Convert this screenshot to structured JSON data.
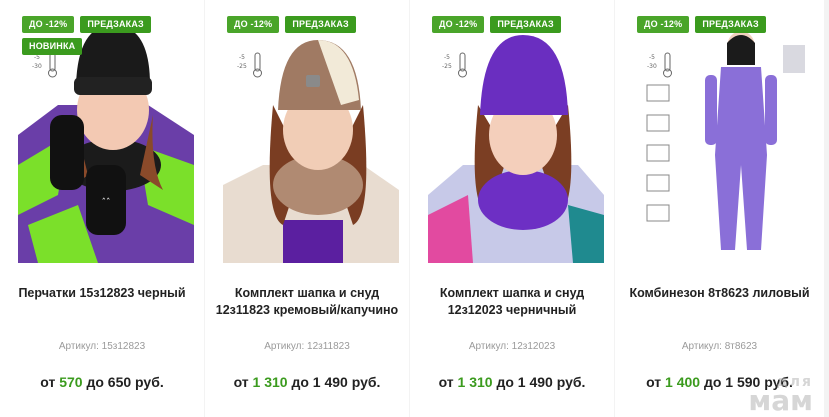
{
  "products": [
    {
      "badges": [
        "ДО -12%",
        "ПРЕДЗАКАЗ",
        "НОВИНКА"
      ],
      "name": "Перчатки 15з12823 черный",
      "sku": "Артикул: 15з12823",
      "price_from_label": "от",
      "price_from": "570",
      "price_to_label": "до",
      "price_to": "650 руб.",
      "temp": [
        "-5",
        "-30"
      ]
    },
    {
      "badges": [
        "ДО -12%",
        "ПРЕДЗАКАЗ"
      ],
      "name": "Комплект шапка и снуд 12з11823 кремовый/капучино",
      "sku": "Артикул: 12з11823",
      "price_from_label": "от",
      "price_from": "1 310",
      "price_to_label": "до",
      "price_to": "1 490 руб.",
      "temp": [
        "-5",
        "-25"
      ]
    },
    {
      "badges": [
        "ДО -12%",
        "ПРЕДЗАКАЗ"
      ],
      "name": "Комплект шапка и снуд 12з12023 черничный",
      "sku": "Артикул: 12з12023",
      "price_from_label": "от",
      "price_from": "1 310",
      "price_to_label": "до",
      "price_to": "1 490 руб.",
      "temp": [
        "-5",
        "-25"
      ]
    },
    {
      "badges": [
        "ДО -12%",
        "ПРЕДЗАКАЗ"
      ],
      "name": "Комбинезон 8т8623 лиловый",
      "sku": "Артикул: 8т8623",
      "price_from_label": "от",
      "price_from": "1 400",
      "price_to_label": "до",
      "price_to": "1 590 руб.",
      "temp": [
        "-5",
        "-30"
      ]
    }
  ],
  "watermark": {
    "top": "для",
    "bottom": "мам"
  },
  "colors": {
    "accent": "#3b9b1e",
    "badge": "#4aa52a"
  }
}
